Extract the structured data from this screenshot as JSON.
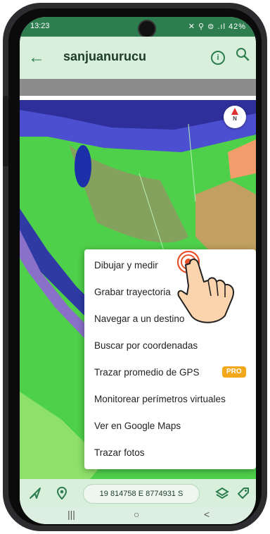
{
  "status": {
    "time": "13:23",
    "icons_text": "✕ ⚲ ⊜ .ıl 42%",
    "battery": "42%"
  },
  "appbar": {
    "title": "sanjuanurucu",
    "back_icon": "arrow-left-icon",
    "info_icon": "info-icon",
    "search_icon": "search-icon"
  },
  "menu": {
    "items": [
      {
        "label": "Dibujar y medir"
      },
      {
        "label": "Grabar trayectoria"
      },
      {
        "label": "Navegar a un destino"
      },
      {
        "label": "Buscar por coordenadas"
      },
      {
        "label": "Trazar promedio de GPS",
        "badge": "PRO"
      },
      {
        "label": "Monitorear perímetros virtuales"
      },
      {
        "label": "Ver en Google Maps"
      },
      {
        "label": "Trazar fotos"
      }
    ]
  },
  "compass": {
    "label": "N"
  },
  "bottombar": {
    "coordinates": "19 814758 E 8774931 S"
  },
  "sysnav": {
    "recents": "|||",
    "home": "○",
    "back": "<"
  },
  "colors": {
    "brand": "#2e7d4f",
    "pro_badge": "#f2a81a",
    "menu_bg": "#ffffff"
  }
}
